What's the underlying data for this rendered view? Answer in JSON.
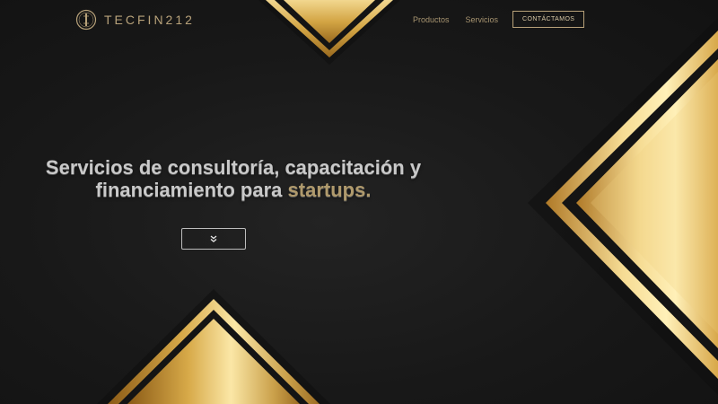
{
  "header": {
    "brand": "TECFIN212",
    "logo_icon": "gold-seal-logo-icon",
    "nav": {
      "products": "Productos",
      "services": "Servicios",
      "contact": "CONTÁCTAMOS"
    }
  },
  "hero": {
    "line1": "Servicios de consultoría, capacitación y",
    "line2_before": "financiamiento para",
    "line2_highlight": "startups."
  },
  "scroll_button": {
    "icon": "double-chevron-down-icon"
  },
  "colors": {
    "accent_gold": "#b8a27a",
    "background": "#1a1a1a"
  }
}
